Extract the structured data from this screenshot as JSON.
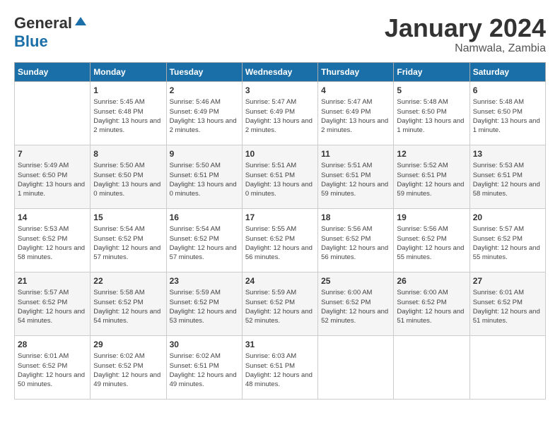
{
  "header": {
    "logo_general": "General",
    "logo_blue": "Blue",
    "month": "January 2024",
    "location": "Namwala, Zambia"
  },
  "days_of_week": [
    "Sunday",
    "Monday",
    "Tuesday",
    "Wednesday",
    "Thursday",
    "Friday",
    "Saturday"
  ],
  "weeks": [
    [
      {
        "day": "",
        "sunrise": "",
        "sunset": "",
        "daylight": ""
      },
      {
        "day": "1",
        "sunrise": "Sunrise: 5:45 AM",
        "sunset": "Sunset: 6:48 PM",
        "daylight": "Daylight: 13 hours and 2 minutes."
      },
      {
        "day": "2",
        "sunrise": "Sunrise: 5:46 AM",
        "sunset": "Sunset: 6:49 PM",
        "daylight": "Daylight: 13 hours and 2 minutes."
      },
      {
        "day": "3",
        "sunrise": "Sunrise: 5:47 AM",
        "sunset": "Sunset: 6:49 PM",
        "daylight": "Daylight: 13 hours and 2 minutes."
      },
      {
        "day": "4",
        "sunrise": "Sunrise: 5:47 AM",
        "sunset": "Sunset: 6:49 PM",
        "daylight": "Daylight: 13 hours and 2 minutes."
      },
      {
        "day": "5",
        "sunrise": "Sunrise: 5:48 AM",
        "sunset": "Sunset: 6:50 PM",
        "daylight": "Daylight: 13 hours and 1 minute."
      },
      {
        "day": "6",
        "sunrise": "Sunrise: 5:48 AM",
        "sunset": "Sunset: 6:50 PM",
        "daylight": "Daylight: 13 hours and 1 minute."
      }
    ],
    [
      {
        "day": "7",
        "sunrise": "Sunrise: 5:49 AM",
        "sunset": "Sunset: 6:50 PM",
        "daylight": "Daylight: 13 hours and 1 minute."
      },
      {
        "day": "8",
        "sunrise": "Sunrise: 5:50 AM",
        "sunset": "Sunset: 6:50 PM",
        "daylight": "Daylight: 13 hours and 0 minutes."
      },
      {
        "day": "9",
        "sunrise": "Sunrise: 5:50 AM",
        "sunset": "Sunset: 6:51 PM",
        "daylight": "Daylight: 13 hours and 0 minutes."
      },
      {
        "day": "10",
        "sunrise": "Sunrise: 5:51 AM",
        "sunset": "Sunset: 6:51 PM",
        "daylight": "Daylight: 13 hours and 0 minutes."
      },
      {
        "day": "11",
        "sunrise": "Sunrise: 5:51 AM",
        "sunset": "Sunset: 6:51 PM",
        "daylight": "Daylight: 12 hours and 59 minutes."
      },
      {
        "day": "12",
        "sunrise": "Sunrise: 5:52 AM",
        "sunset": "Sunset: 6:51 PM",
        "daylight": "Daylight: 12 hours and 59 minutes."
      },
      {
        "day": "13",
        "sunrise": "Sunrise: 5:53 AM",
        "sunset": "Sunset: 6:51 PM",
        "daylight": "Daylight: 12 hours and 58 minutes."
      }
    ],
    [
      {
        "day": "14",
        "sunrise": "Sunrise: 5:53 AM",
        "sunset": "Sunset: 6:52 PM",
        "daylight": "Daylight: 12 hours and 58 minutes."
      },
      {
        "day": "15",
        "sunrise": "Sunrise: 5:54 AM",
        "sunset": "Sunset: 6:52 PM",
        "daylight": "Daylight: 12 hours and 57 minutes."
      },
      {
        "day": "16",
        "sunrise": "Sunrise: 5:54 AM",
        "sunset": "Sunset: 6:52 PM",
        "daylight": "Daylight: 12 hours and 57 minutes."
      },
      {
        "day": "17",
        "sunrise": "Sunrise: 5:55 AM",
        "sunset": "Sunset: 6:52 PM",
        "daylight": "Daylight: 12 hours and 56 minutes."
      },
      {
        "day": "18",
        "sunrise": "Sunrise: 5:56 AM",
        "sunset": "Sunset: 6:52 PM",
        "daylight": "Daylight: 12 hours and 56 minutes."
      },
      {
        "day": "19",
        "sunrise": "Sunrise: 5:56 AM",
        "sunset": "Sunset: 6:52 PM",
        "daylight": "Daylight: 12 hours and 55 minutes."
      },
      {
        "day": "20",
        "sunrise": "Sunrise: 5:57 AM",
        "sunset": "Sunset: 6:52 PM",
        "daylight": "Daylight: 12 hours and 55 minutes."
      }
    ],
    [
      {
        "day": "21",
        "sunrise": "Sunrise: 5:57 AM",
        "sunset": "Sunset: 6:52 PM",
        "daylight": "Daylight: 12 hours and 54 minutes."
      },
      {
        "day": "22",
        "sunrise": "Sunrise: 5:58 AM",
        "sunset": "Sunset: 6:52 PM",
        "daylight": "Daylight: 12 hours and 54 minutes."
      },
      {
        "day": "23",
        "sunrise": "Sunrise: 5:59 AM",
        "sunset": "Sunset: 6:52 PM",
        "daylight": "Daylight: 12 hours and 53 minutes."
      },
      {
        "day": "24",
        "sunrise": "Sunrise: 5:59 AM",
        "sunset": "Sunset: 6:52 PM",
        "daylight": "Daylight: 12 hours and 52 minutes."
      },
      {
        "day": "25",
        "sunrise": "Sunrise: 6:00 AM",
        "sunset": "Sunset: 6:52 PM",
        "daylight": "Daylight: 12 hours and 52 minutes."
      },
      {
        "day": "26",
        "sunrise": "Sunrise: 6:00 AM",
        "sunset": "Sunset: 6:52 PM",
        "daylight": "Daylight: 12 hours and 51 minutes."
      },
      {
        "day": "27",
        "sunrise": "Sunrise: 6:01 AM",
        "sunset": "Sunset: 6:52 PM",
        "daylight": "Daylight: 12 hours and 51 minutes."
      }
    ],
    [
      {
        "day": "28",
        "sunrise": "Sunrise: 6:01 AM",
        "sunset": "Sunset: 6:52 PM",
        "daylight": "Daylight: 12 hours and 50 minutes."
      },
      {
        "day": "29",
        "sunrise": "Sunrise: 6:02 AM",
        "sunset": "Sunset: 6:52 PM",
        "daylight": "Daylight: 12 hours and 49 minutes."
      },
      {
        "day": "30",
        "sunrise": "Sunrise: 6:02 AM",
        "sunset": "Sunset: 6:51 PM",
        "daylight": "Daylight: 12 hours and 49 minutes."
      },
      {
        "day": "31",
        "sunrise": "Sunrise: 6:03 AM",
        "sunset": "Sunset: 6:51 PM",
        "daylight": "Daylight: 12 hours and 48 minutes."
      },
      {
        "day": "",
        "sunrise": "",
        "sunset": "",
        "daylight": ""
      },
      {
        "day": "",
        "sunrise": "",
        "sunset": "",
        "daylight": ""
      },
      {
        "day": "",
        "sunrise": "",
        "sunset": "",
        "daylight": ""
      }
    ]
  ]
}
